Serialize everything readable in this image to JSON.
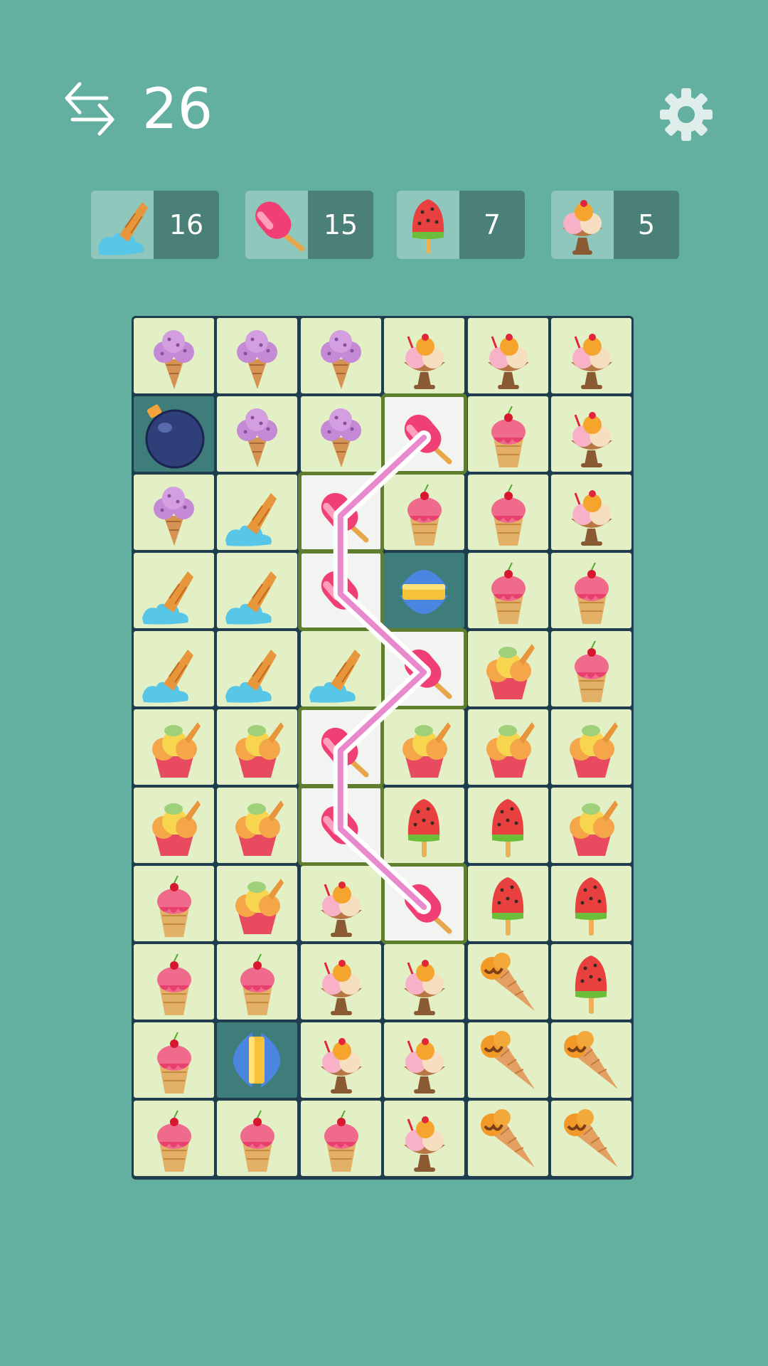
{
  "header": {
    "moves_left": "26",
    "swap_icon": "swap-arrows-icon",
    "settings_icon": "gear-icon"
  },
  "goals": [
    {
      "icon": "melted-cone-icon",
      "count": "16"
    },
    {
      "icon": "pink-popsicle-icon",
      "count": "15"
    },
    {
      "icon": "watermelon-popsicle-icon",
      "count": "7"
    },
    {
      "icon": "sundae-icon",
      "count": "5"
    }
  ],
  "board": {
    "columns": 6,
    "rows": 11,
    "grid": [
      [
        "purple-cone",
        "purple-cone",
        "purple-cone",
        "sundae",
        "sundae",
        "sundae"
      ],
      [
        "bomb",
        "purple-cone",
        "purple-cone",
        "popsicle",
        "cherry-cone",
        "sundae"
      ],
      [
        "purple-cone",
        "melted-cone",
        "popsicle",
        "cherry-cone",
        "cherry-cone",
        "sundae"
      ],
      [
        "melted-cone",
        "melted-cone",
        "popsicle",
        "blue-booster-horizontal",
        "cherry-cone",
        "cherry-cone"
      ],
      [
        "melted-cone",
        "melted-cone",
        "melted-cone",
        "popsicle",
        "ice-cream-cup",
        "cherry-cone"
      ],
      [
        "ice-cream-cup",
        "ice-cream-cup",
        "popsicle",
        "ice-cream-cup",
        "ice-cream-cup",
        "ice-cream-cup"
      ],
      [
        "ice-cream-cup",
        "ice-cream-cup",
        "popsicle",
        "watermelon-pop",
        "watermelon-pop",
        "ice-cream-cup"
      ],
      [
        "cherry-cone",
        "ice-cream-cup",
        "sundae",
        "popsicle",
        "watermelon-pop",
        "watermelon-pop"
      ],
      [
        "cherry-cone",
        "cherry-cone",
        "sundae",
        "sundae",
        "caramel-cone",
        "watermelon-pop"
      ],
      [
        "cherry-cone",
        "blue-booster-vertical",
        "sundae",
        "sundae",
        "caramel-cone",
        "caramel-cone"
      ],
      [
        "cherry-cone",
        "cherry-cone",
        "cherry-cone",
        "sundae",
        "caramel-cone",
        "caramel-cone"
      ]
    ],
    "selected": [
      [
        1,
        3
      ],
      [
        2,
        2
      ],
      [
        3,
        2
      ],
      [
        4,
        3
      ],
      [
        5,
        2
      ],
      [
        6,
        2
      ],
      [
        7,
        3
      ]
    ],
    "empty_cells": [
      [
        1,
        0
      ],
      [
        3,
        3
      ],
      [
        9,
        1
      ]
    ]
  },
  "colors": {
    "background": "#63b0a0",
    "board": "#1f3d4f",
    "tile": "#e3f0c5",
    "selected_border": "#5f7f2f",
    "path": "#e889cb"
  }
}
